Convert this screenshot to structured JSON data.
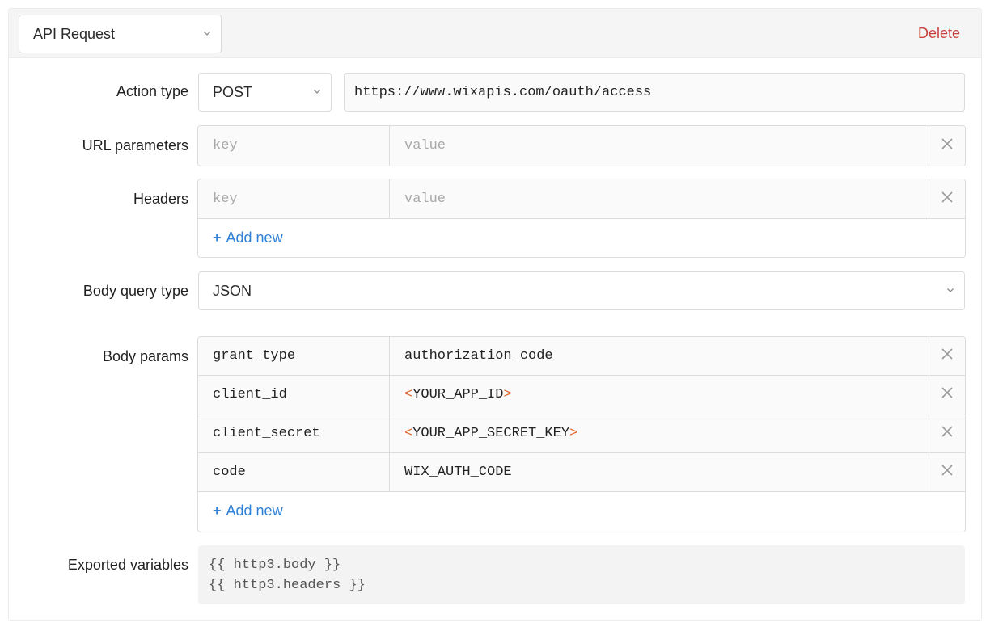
{
  "header": {
    "action_select": "API Request",
    "delete_label": "Delete"
  },
  "action_type": {
    "label": "Action type",
    "method": "POST",
    "url": "https://www.wixapis.com/oauth/access"
  },
  "url_parameters": {
    "label": "URL parameters",
    "key_placeholder": "key",
    "value_placeholder": "value"
  },
  "headers": {
    "label": "Headers",
    "key_placeholder": "key",
    "value_placeholder": "value",
    "add_label": "Add new"
  },
  "body_query_type": {
    "label": "Body query type",
    "value": "JSON"
  },
  "body_params": {
    "label": "Body params",
    "rows": [
      {
        "key": "grant_type",
        "value": "authorization_code"
      },
      {
        "key": "client_id",
        "value": "YOUR_APP_ID",
        "bracketed": true
      },
      {
        "key": "client_secret",
        "value": "YOUR_APP_SECRET_KEY",
        "bracketed": true
      },
      {
        "key": "code",
        "value": "WIX_AUTH_CODE"
      }
    ],
    "add_label": "Add new"
  },
  "exported_variables": {
    "label": "Exported variables",
    "lines": [
      "{{ http3.body }}",
      "{{ http3.headers }}"
    ]
  },
  "icons": {
    "plus": "plus-icon",
    "remove": "close-icon",
    "dropdown": "chevron-down-icon"
  },
  "colors": {
    "delete": "#c9413f",
    "link": "#2f80d6",
    "bracket": "#e0632c"
  }
}
